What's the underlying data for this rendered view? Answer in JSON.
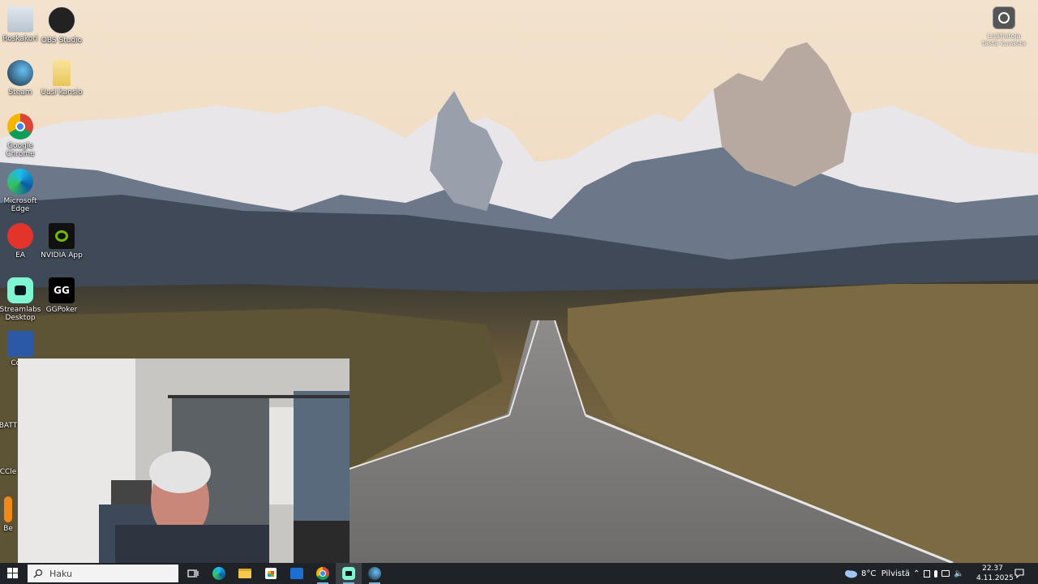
{
  "desktop": {
    "icons": [
      {
        "label": "Roskakori"
      },
      {
        "label": "OBS Studio"
      },
      {
        "label": "Steam"
      },
      {
        "label": "Uusi kansio"
      },
      {
        "label": "Google Chrome"
      },
      {
        "label": "Microsoft Edge"
      },
      {
        "label": "EA"
      },
      {
        "label": "NVIDIA App"
      },
      {
        "label": "Streamlabs Desktop"
      },
      {
        "label": "GGPoker"
      },
      {
        "label": "Coun"
      },
      {
        "label": "BATT"
      },
      {
        "label": "CCle"
      },
      {
        "label": "Be"
      }
    ],
    "widget_label": "Lisätietoja tästä kuvasta"
  },
  "taskbar": {
    "search_placeholder": "Haku",
    "weather": "8°C  Pilvistä",
    "time": "22.37",
    "date": "4.11.2025"
  }
}
